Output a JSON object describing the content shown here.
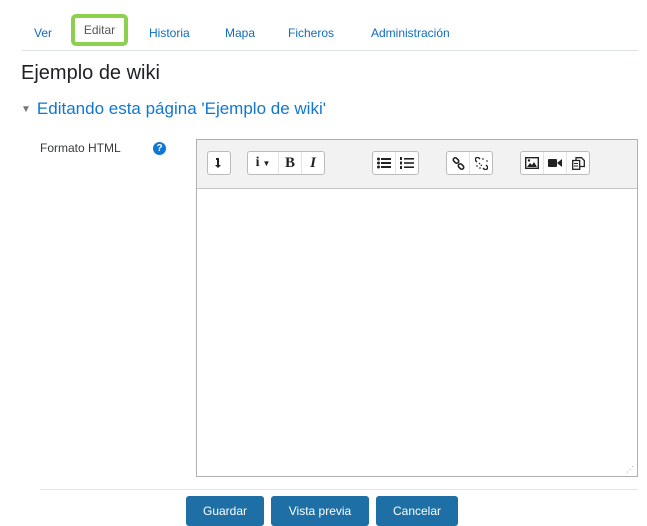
{
  "tabs": [
    {
      "label": "Ver"
    },
    {
      "label": "Editar",
      "active": true
    },
    {
      "label": "Historia"
    },
    {
      "label": "Mapa"
    },
    {
      "label": "Ficheros"
    },
    {
      "label": "Administración"
    }
  ],
  "page_title": "Ejemplo de wiki",
  "section_title": "Editando esta página 'Ejemplo de wiki'",
  "field": {
    "label": "Formato HTML",
    "help_icon": "question-circle",
    "value": ""
  },
  "toolbar": {
    "group1": [
      "collapse"
    ],
    "group2": [
      "style-info",
      "bold",
      "italic"
    ],
    "group3": [
      "unordered-list",
      "ordered-list"
    ],
    "group4": [
      "link",
      "unlink"
    ],
    "group5": [
      "image",
      "video",
      "manage-files"
    ]
  },
  "buttons": {
    "save": "Guardar",
    "preview": "Vista previa",
    "cancel": "Cancelar"
  },
  "colors": {
    "accent": "#1177d1",
    "button": "#1d6fa5",
    "highlight": "#8cd04f"
  }
}
